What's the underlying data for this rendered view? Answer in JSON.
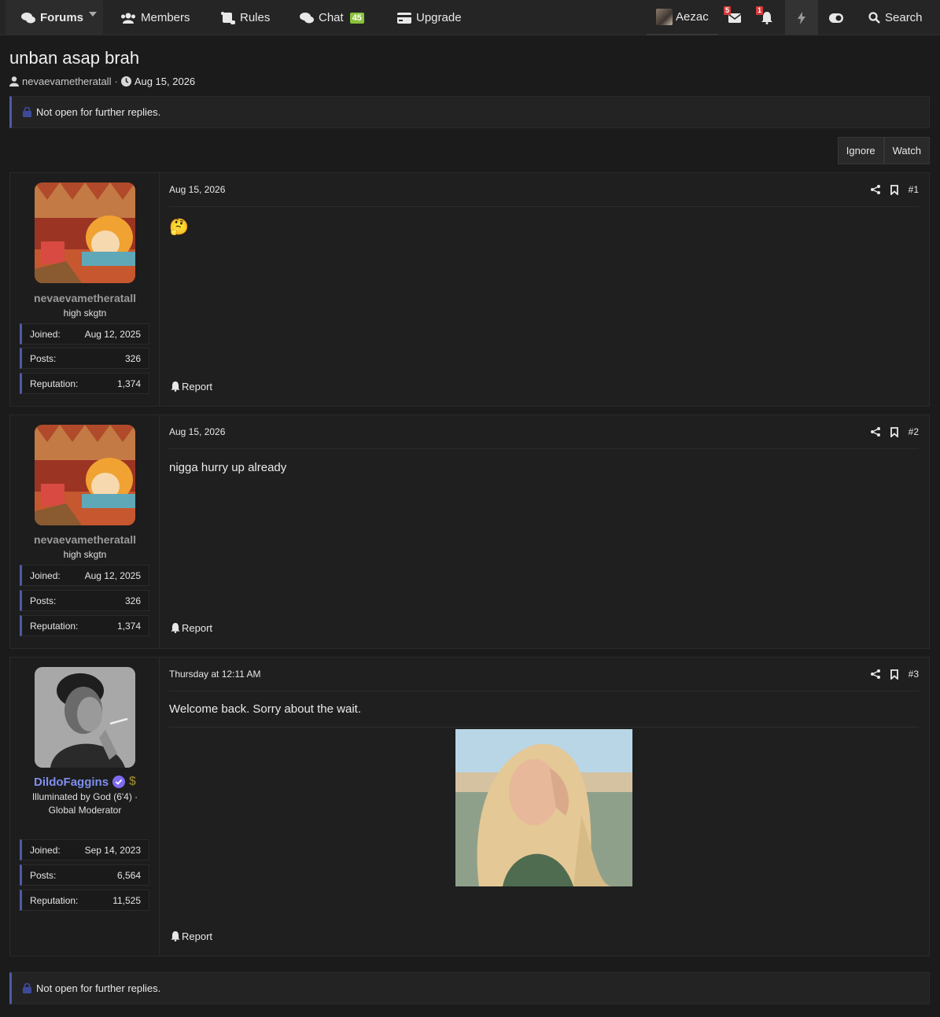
{
  "nav": {
    "forums": "Forums",
    "members": "Members",
    "rules": "Rules",
    "chat": "Chat",
    "chat_count": "45",
    "upgrade": "Upgrade",
    "user": "Aezac",
    "inbox_count": "5",
    "alerts_count": "1",
    "search": "Search"
  },
  "thread": {
    "title": "unban asap brah",
    "author": "nevaevametheratall",
    "date": "Aug 15, 2026",
    "locked_notice": "Not open for further replies.",
    "ignore_label": "Ignore",
    "watch_label": "Watch"
  },
  "labels": {
    "joined": "Joined:",
    "posts": "Posts:",
    "reputation": "Reputation:",
    "report": "Report"
  },
  "posts": [
    {
      "number": "#1",
      "date": "Aug 15, 2026",
      "body": "",
      "emoji": "🤔",
      "user": {
        "name": "nevaevametheratall",
        "title": "high skgtn",
        "joined": "Aug 12, 2025",
        "posts": "326",
        "reputation": "1,374"
      }
    },
    {
      "number": "#2",
      "date": "Aug 15, 2026",
      "body": "nigga hurry up already",
      "user": {
        "name": "nevaevametheratall",
        "title": "high skgtn",
        "joined": "Aug 12, 2025",
        "posts": "326",
        "reputation": "1,374"
      }
    },
    {
      "number": "#3",
      "date": "Thursday at 12:11 AM",
      "body": "Welcome back. Sorry about the wait.",
      "user": {
        "name": "DildoFaggins",
        "title_line1": "Illuminated by God (6'4) ·",
        "title_line2": "Global Moderator",
        "joined": "Sep 14, 2023",
        "posts": "6,564",
        "reputation": "11,525"
      }
    }
  ],
  "colors": {
    "accent": "#4f5aa8",
    "chat_badge": "#8ac23b",
    "alert_badge": "#d43a3a",
    "moderator_name": "#7e8ff0"
  }
}
